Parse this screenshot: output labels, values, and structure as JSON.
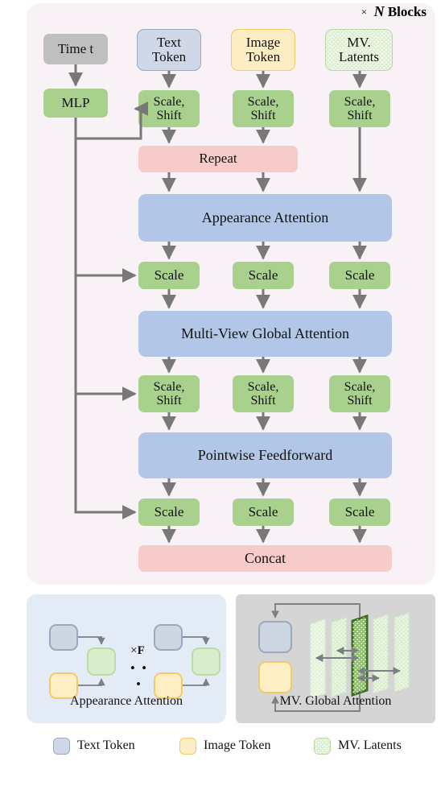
{
  "header": {
    "times_symbol": "×",
    "n_symbol": "N",
    "blocks_label": "Blocks"
  },
  "main_flow": {
    "inputs": [
      {
        "id": "time",
        "label": "Time t",
        "style": "gray"
      },
      {
        "id": "text",
        "label": "Text\nToken",
        "style": "text"
      },
      {
        "id": "image",
        "label": "Image\nToken",
        "style": "image"
      },
      {
        "id": "mv",
        "label": "MV.\nLatents",
        "style": "mv"
      }
    ],
    "mlp_label": "MLP",
    "row_scale_shift_1": [
      "Scale,\nShift",
      "Scale,\nShift",
      "Scale,\nShift"
    ],
    "repeat_label": "Repeat",
    "appearance_attention_label": "Appearance Attention",
    "row_scale_1": [
      "Scale",
      "Scale",
      "Scale"
    ],
    "mv_global_attention_label": "Multi-View Global Attention",
    "row_scale_shift_2": [
      "Scale,\nShift",
      "Scale,\nShift",
      "Scale,\nShift"
    ],
    "pointwise_feedforward_label": "Pointwise Feedforward",
    "row_scale_2": [
      "Scale",
      "Scale",
      "Scale"
    ],
    "concat_label": "Concat"
  },
  "sub_panels": [
    {
      "id": "appearance",
      "caption": "Appearance Attention",
      "repeat_times_symbol": "×",
      "repeat_count_symbol": "F",
      "ellipsis": "• • •",
      "groups": 2
    },
    {
      "id": "mvglobal",
      "caption": "MV. Global Attention",
      "plane_count": 5,
      "highlighted_plane_index": 3
    }
  ],
  "legend": {
    "items": [
      {
        "label": "Text Token",
        "swatch": "text"
      },
      {
        "label": "Image Token",
        "swatch": "image"
      },
      {
        "label": "MV. Latents",
        "swatch": "mv"
      }
    ]
  },
  "colors": {
    "main_panel_bg": "#f8f2f7",
    "appearance_panel_bg": "#e3ebf7",
    "mvglobal_panel_bg": "#d5d5d5",
    "green": "#a9d18e",
    "blue": "#b2c7e7",
    "pink": "#f6ccca",
    "gray": "#bfbfbf",
    "text_token": "#d0d8e8",
    "image_token": "#fdedc4",
    "mv_latents": "#ddeed2",
    "arrow": "#787878",
    "thin_arrow": "#7b8083",
    "highlight_plane": "#8fc06a",
    "highlight_plane_edge": "#3f6b24"
  }
}
